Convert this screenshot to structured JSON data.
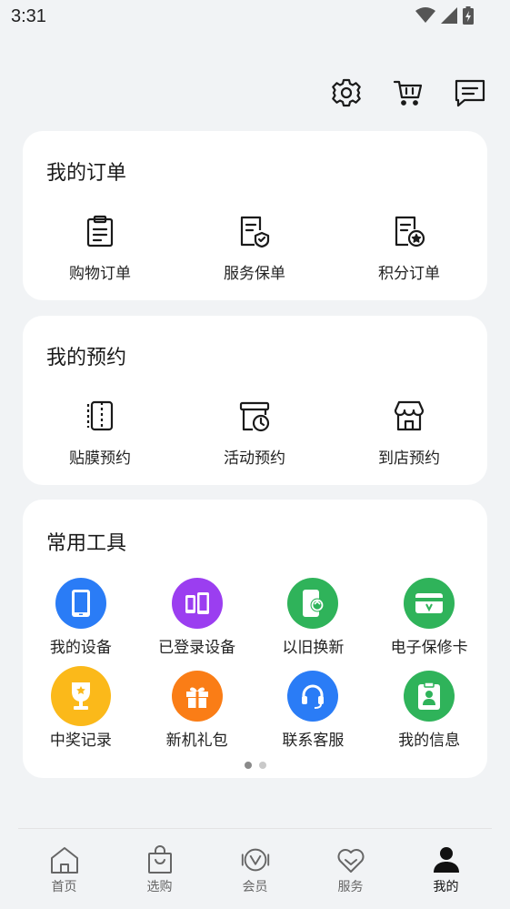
{
  "status_bar": {
    "time": "3:31",
    "icons": [
      "wifi-icon",
      "signal-icon",
      "battery-icon"
    ]
  },
  "header_icons": [
    "settings-icon",
    "cart-icon",
    "message-icon"
  ],
  "orders": {
    "title": "我的订单",
    "items": [
      {
        "label": "购物订单",
        "icon": "clipboard-icon"
      },
      {
        "label": "服务保单",
        "icon": "shield-doc-icon"
      },
      {
        "label": "积分订单",
        "icon": "star-doc-icon"
      }
    ]
  },
  "reservations": {
    "title": "我的预约",
    "items": [
      {
        "label": "贴膜预约",
        "icon": "film-icon"
      },
      {
        "label": "活动预约",
        "icon": "calendar-clock-icon"
      },
      {
        "label": "到店预约",
        "icon": "store-icon"
      }
    ]
  },
  "tools": {
    "title": "常用工具",
    "items": [
      {
        "label": "我的设备",
        "icon": "phone-icon",
        "color": "#2a7cf6"
      },
      {
        "label": "已登录设备",
        "icon": "devices-icon",
        "color": "#9b3ef0"
      },
      {
        "label": "以旧换新",
        "icon": "trade-in-icon",
        "color": "#2fb35a"
      },
      {
        "label": "电子保修卡",
        "icon": "warranty-card-icon",
        "color": "#2fb35a"
      },
      {
        "label": "中奖记录",
        "icon": "trophy-icon",
        "color": "#fbb91a"
      },
      {
        "label": "新机礼包",
        "icon": "gift-icon",
        "color": "#fa7d16"
      },
      {
        "label": "联系客服",
        "icon": "headset-icon",
        "color": "#2a7cf6"
      },
      {
        "label": "我的信息",
        "icon": "id-card-icon",
        "color": "#2fb35a"
      }
    ],
    "pages": 2,
    "current_page": 1
  },
  "nav": [
    {
      "label": "首页",
      "icon": "home-icon",
      "active": false
    },
    {
      "label": "选购",
      "icon": "shopping-bag-icon",
      "active": false
    },
    {
      "label": "会员",
      "icon": "member-icon",
      "active": false
    },
    {
      "label": "服务",
      "icon": "heart-icon",
      "active": false
    },
    {
      "label": "我的",
      "icon": "person-icon",
      "active": true
    }
  ]
}
